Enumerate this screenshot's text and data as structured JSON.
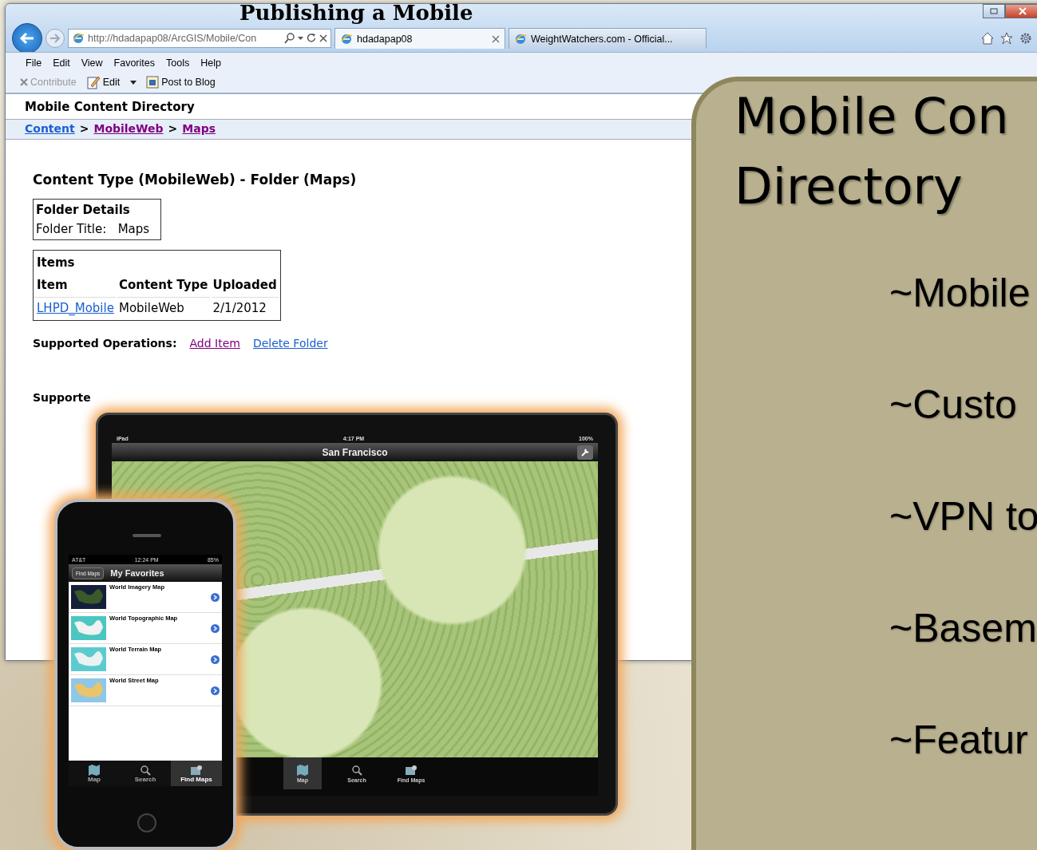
{
  "slide": {
    "title": "Publishing a Mobile"
  },
  "browser": {
    "address": "http://hdadapap08/ArcGIS/Mobile/Con",
    "tabs": [
      {
        "label": "hdadapap08",
        "selected": true
      },
      {
        "label": "WeightWatchers.com - Official...",
        "selected": false
      }
    ],
    "menu": [
      "File",
      "Edit",
      "View",
      "Favorites",
      "Tools",
      "Help"
    ],
    "commands": [
      {
        "kind": "close",
        "label": "Contribute",
        "disabled": true
      },
      {
        "kind": "edit",
        "label": "Edit",
        "disabled": false
      },
      {
        "kind": "blog",
        "label": "Post to Blog",
        "disabled": false
      }
    ]
  },
  "page": {
    "header": "Mobile Content Directory",
    "breadcrumb": [
      {
        "label": "Content",
        "visited": false
      },
      {
        "label": "MobileWeb",
        "visited": true
      },
      {
        "label": "Maps",
        "visited": true
      }
    ],
    "breadcrumb_separators": [
      ">",
      ">"
    ],
    "heading": "Content Type (MobileWeb) - Folder (Maps)",
    "folder_details": {
      "title": "Folder Details",
      "label": "Folder Title:",
      "value": "Maps"
    },
    "items": {
      "title": "Items",
      "columns": [
        "Item",
        "Content Type",
        "Uploaded"
      ],
      "rows": [
        [
          "LHPD_Mobile",
          "MobileWeb",
          "2/1/2012"
        ]
      ]
    },
    "operations": {
      "label": "Supported Operations:",
      "links": [
        {
          "label": "Add Item",
          "visited": true
        },
        {
          "label": "Delete Folder",
          "visited": false
        }
      ]
    },
    "supported_label": "Supporte"
  },
  "devices": {
    "tablet": {
      "device": "iPad",
      "time": "4:17 PM",
      "battery": "100%",
      "title": "San Francisco",
      "tabs": [
        {
          "label": "Map",
          "selected": true
        },
        {
          "label": "Search",
          "selected": false
        },
        {
          "label": "Find Maps",
          "selected": false
        }
      ]
    },
    "phone": {
      "carrier": "AT&T",
      "time": "12:24 PM",
      "battery": "85%",
      "back": "Find Maps",
      "title": "My Favorites",
      "maps": [
        {
          "title": "World Imagery Map",
          "kind": "imagery"
        },
        {
          "title": "World Topographic Map",
          "kind": "topographic"
        },
        {
          "title": "World Terrain Map",
          "kind": "terrain"
        },
        {
          "title": "World Street Map",
          "kind": "street"
        }
      ],
      "tabs": [
        {
          "label": "Map",
          "selected": false
        },
        {
          "label": "Search",
          "selected": false
        },
        {
          "label": "Find Maps",
          "selected": true
        }
      ]
    }
  },
  "panel": {
    "title_lines": [
      "Mobile Con",
      "Directory"
    ],
    "bullets": [
      "~Mobile",
      "~Custo",
      "~VPN to",
      "~Basem",
      "~Featur"
    ]
  }
}
